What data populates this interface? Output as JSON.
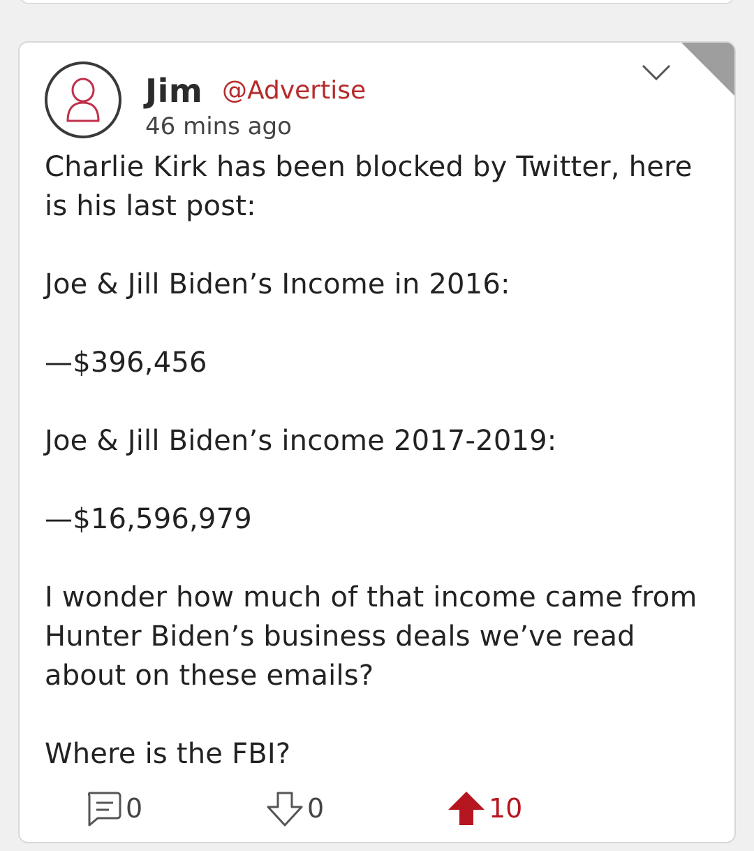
{
  "post": {
    "author_name": "Jim",
    "author_handle": "@Advertise",
    "timestamp": "46 mins ago",
    "body": [
      "Charlie Kirk has been blocked by Twitter, here is his last post:",
      "",
      "Joe & Jill Biden’s Income in 2016:",
      "",
      "—$396,456",
      "",
      "Joe & Jill Biden’s income 2017-2019:",
      "",
      "—$16,596,979",
      "",
      "I wonder how much of that income came from Hunter Biden’s business deals we’ve read about on these emails?",
      "",
      "Where is the FBI?"
    ]
  },
  "actions": {
    "comments_count": "0",
    "downvotes_count": "0",
    "upvotes_count": "10"
  },
  "icons": {
    "avatar": "user-icon",
    "menu": "chevron-down-icon",
    "comment": "comment-icon",
    "downvote": "downvote-icon",
    "upvote": "upvote-icon"
  },
  "colors": {
    "accent": "#b52b2b",
    "upvote": "#b5161f",
    "text": "#222222"
  }
}
